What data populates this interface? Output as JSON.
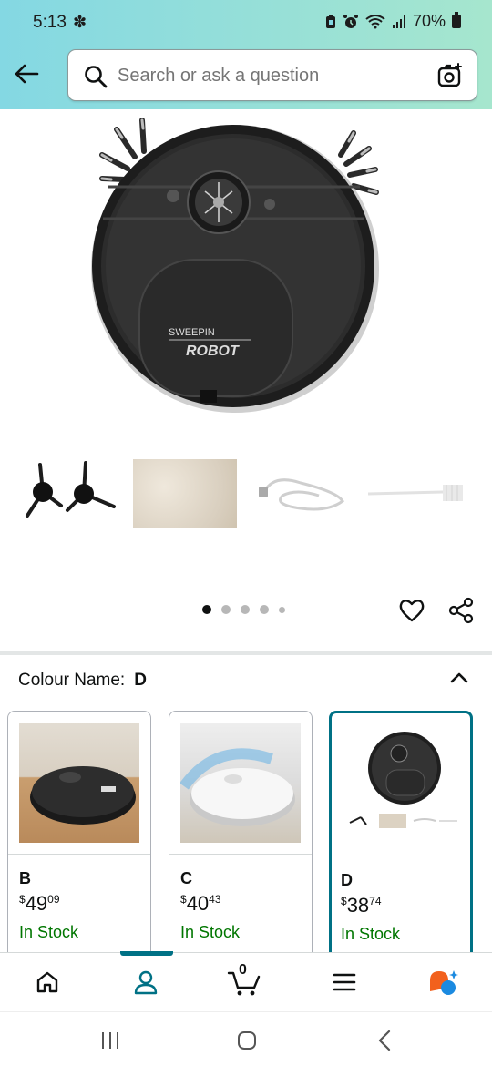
{
  "status_bar": {
    "time": "5:13",
    "battery": "70%"
  },
  "search": {
    "placeholder": "Search or ask a question"
  },
  "gallery": {
    "product_brand_text_line1": "SWEEPIN",
    "product_brand_text_line2": "ROBOT",
    "dots_total": 5,
    "active_dot": 1
  },
  "colour": {
    "label": "Colour Name:",
    "selected": "D"
  },
  "variants": [
    {
      "name": "B",
      "currency": "$",
      "whole": "49",
      "fraction": "09",
      "stock": "In Stock"
    },
    {
      "name": "C",
      "currency": "$",
      "whole": "40",
      "fraction": "43",
      "stock": "In Stock"
    },
    {
      "name": "D",
      "currency": "$",
      "whole": "38",
      "fraction": "74",
      "stock": "In Stock",
      "selected": true
    }
  ],
  "bottom_nav": {
    "cart_count": "0"
  },
  "colors": {
    "accent": "#007185",
    "stock_green": "#007600",
    "header_gradient_start": "#84d8e3",
    "header_gradient_end": "#a6e6ce"
  }
}
